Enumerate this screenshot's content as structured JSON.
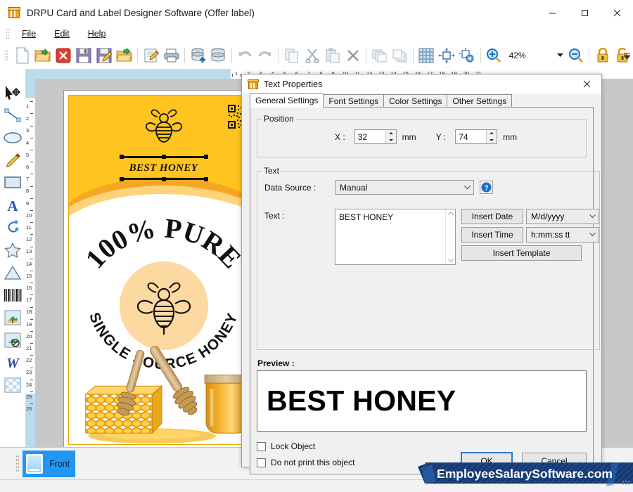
{
  "window": {
    "title": "DRPU Card and Label Designer Software (Offer label)",
    "icon": "card-designer-icon",
    "minimize": "—",
    "maximize": "☐",
    "close": "✕"
  },
  "menubar": {
    "items": [
      "File",
      "Edit",
      "Help"
    ]
  },
  "toolbar": {
    "zoom_level": "42%",
    "buttons": [
      {
        "name": "new-document-icon",
        "title": "New"
      },
      {
        "name": "open-document-icon",
        "title": "Open"
      },
      {
        "name": "close-document-icon",
        "title": "Close"
      },
      {
        "name": "save-icon",
        "title": "Save"
      },
      {
        "name": "save-as-icon",
        "title": "Save As"
      },
      {
        "name": "open-recent-icon",
        "title": "Open Recent"
      },
      {
        "name": "edit-icon",
        "title": "Edit"
      },
      {
        "name": "print-icon",
        "title": "Print"
      },
      {
        "name": "database-add-icon",
        "title": "Add Database"
      },
      {
        "name": "database-icon",
        "title": "Database"
      },
      {
        "name": "undo-icon",
        "title": "Undo"
      },
      {
        "name": "redo-icon",
        "title": "Redo"
      },
      {
        "name": "copy-icon",
        "title": "Copy"
      },
      {
        "name": "cut-icon",
        "title": "Cut"
      },
      {
        "name": "paste-icon",
        "title": "Paste"
      },
      {
        "name": "delete-icon",
        "title": "Delete"
      },
      {
        "name": "bring-to-front-icon",
        "title": "Bring To Front"
      },
      {
        "name": "send-to-back-icon",
        "title": "Send To Back"
      },
      {
        "name": "grid-icon",
        "title": "Grid"
      },
      {
        "name": "align-object-icon",
        "title": "Align"
      },
      {
        "name": "object-settings-icon",
        "title": "Object Settings"
      },
      {
        "name": "zoom-in-icon",
        "title": "Zoom In"
      },
      {
        "name": "zoom-out-icon",
        "title": "Zoom Out"
      },
      {
        "name": "lock-icon",
        "title": "Lock"
      },
      {
        "name": "unlock-icon",
        "title": "Unlock"
      }
    ]
  },
  "left_tools": [
    {
      "name": "select-tool-icon",
      "label": "Select"
    },
    {
      "name": "line-tool-icon",
      "label": "Line"
    },
    {
      "name": "ellipse-tool-icon",
      "label": "Ellipse"
    },
    {
      "name": "pencil-tool-icon",
      "label": "Pencil"
    },
    {
      "name": "rectangle-tool-icon",
      "label": "Rectangle"
    },
    {
      "name": "text-tool-icon",
      "label": "Text"
    },
    {
      "name": "curve-tool-icon",
      "label": "Curve"
    },
    {
      "name": "star-tool-icon",
      "label": "Star"
    },
    {
      "name": "triangle-tool-icon",
      "label": "Triangle"
    },
    {
      "name": "barcode-tool-icon",
      "label": "Barcode"
    },
    {
      "name": "image-tool-icon",
      "label": "Image"
    },
    {
      "name": "watermark-tool-icon",
      "label": "Watermark"
    },
    {
      "name": "word-art-tool-icon",
      "label": "Word Art"
    },
    {
      "name": "background-tool-icon",
      "label": "Background"
    }
  ],
  "rulers": {
    "horizontal_ticks": [
      1,
      2,
      3,
      4,
      5,
      6,
      7,
      8,
      9,
      10,
      11,
      12,
      13,
      14,
      15,
      16,
      17,
      18,
      19,
      20,
      21
    ],
    "vertical_ticks": [
      1,
      2,
      3,
      4,
      5,
      6,
      7,
      8,
      9,
      10,
      11,
      12,
      13,
      14,
      15,
      16,
      17,
      18,
      19,
      20,
      21,
      22,
      23,
      24,
      25,
      26
    ]
  },
  "canvas": {
    "label_text_top": "BEST HONEY",
    "arc_text_top": "100% PURE",
    "arc_text_bottom": "SINGLE SOURCE HONEY"
  },
  "page_tabs": [
    {
      "label": "Front",
      "icon": "card-face-icon",
      "selected": true
    }
  ],
  "banner": {
    "text": "EmployeeSalarySoftware.com"
  },
  "dialog": {
    "title": "Text Properties",
    "icon": "text-properties-icon",
    "close": "✕",
    "tabs": [
      {
        "label": "General Settings",
        "active": true
      },
      {
        "label": "Font Settings",
        "active": false
      },
      {
        "label": "Color Settings",
        "active": false
      },
      {
        "label": "Other Settings",
        "active": false
      }
    ],
    "position": {
      "legend": "Position",
      "x_label": "X :",
      "x_value": "32",
      "x_unit": "mm",
      "y_label": "Y :",
      "y_value": "74",
      "y_unit": "mm"
    },
    "text": {
      "legend": "Text",
      "data_source_label": "Data Source :",
      "data_source_value": "Manual",
      "help_icon": "help-icon",
      "text_label": "Text :",
      "text_value": "BEST HONEY",
      "insert_date_label": "Insert Date",
      "date_format": "M/d/yyyy",
      "insert_time_label": "Insert Time",
      "time_format": "h:mm:ss tt",
      "insert_template_label": "Insert Template"
    },
    "preview": {
      "label": "Preview :",
      "value": "BEST HONEY"
    },
    "options": [
      {
        "label": "Lock Object",
        "checked": false
      },
      {
        "label": "Do not print this object",
        "checked": false
      }
    ],
    "ok_label": "OK",
    "cancel_label": "Cancel"
  },
  "colors": {
    "accent": "#2196f3",
    "label_yellow": "#ffc41f",
    "label_orange": "#f5a623",
    "banner_blue": "#1d3f7a",
    "focus_blue": "#2f79c0"
  }
}
